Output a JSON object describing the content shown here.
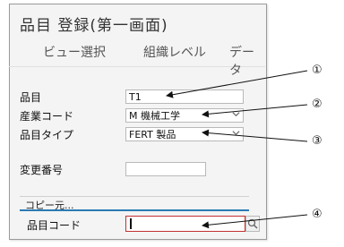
{
  "title": "品目 登録(第一画面)",
  "menu": {
    "items": [
      "ビュー選択",
      "組織レベル",
      "データ"
    ]
  },
  "fields": {
    "material": {
      "label": "品目",
      "value": "T1"
    },
    "industry": {
      "label": "産業コード",
      "value": "M 機械工学"
    },
    "material_type": {
      "label": "品目タイプ",
      "value": "FERT 製品"
    },
    "change_number": {
      "label": "変更番号",
      "value": ""
    }
  },
  "copy_section": {
    "title": "コピー元...",
    "material_code_label": "品目コード",
    "material_code_value": ""
  },
  "callouts": [
    "①",
    "②",
    "③",
    "④"
  ],
  "colors": {
    "accent_blue": "#2a7ab3",
    "focus_red": "#c03030"
  },
  "icons": {
    "dropdown": "chevron-down-icon",
    "search": "search-icon"
  }
}
